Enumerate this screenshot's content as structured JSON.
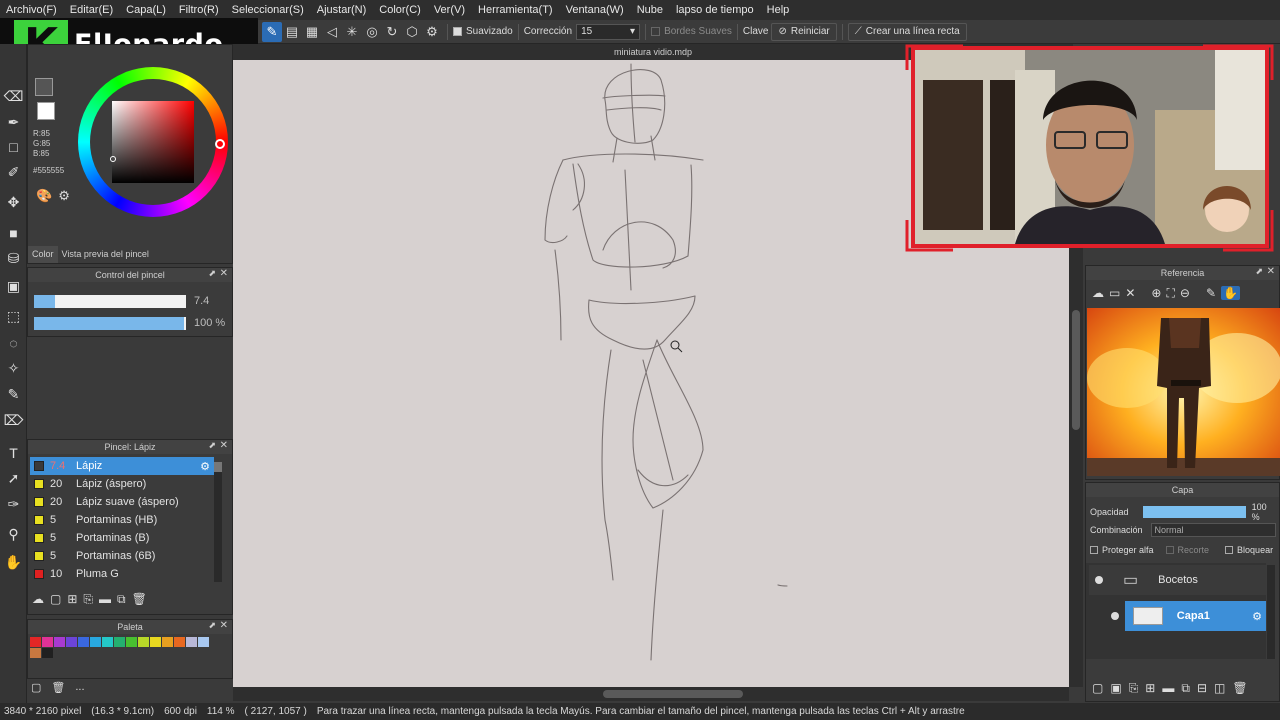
{
  "menu": [
    "Archivo(F)",
    "Editar(E)",
    "Capa(L)",
    "Filtro(R)",
    "Seleccionar(S)",
    "Ajustar(N)",
    "Color(C)",
    "Ver(V)",
    "Herramienta(T)",
    "Ventana(W)",
    "Nube",
    "lapso de tiempo",
    "Help"
  ],
  "logo": {
    "letter": "K",
    "name": "ElJonardo"
  },
  "options_bar": {
    "suavizado": "Suavizado",
    "correccion_label": "Corrección",
    "correccion_value": "15",
    "bordes_suaves": "Bordes Suaves",
    "clave": "Clave",
    "reiniciar": "Reiniciar",
    "linea_recta": "Crear una línea recta"
  },
  "canvas": {
    "tab_title": "miniatura vidio.mdp"
  },
  "color_panel": {
    "r": "R:85",
    "g": "G:85",
    "b": "B:85",
    "hex": "#555555",
    "tab_color": "Color",
    "tab_preview": "Vista previa del pincel",
    "fg_color": "#555555",
    "bg_color": "#ffffff"
  },
  "brush_control": {
    "title": "Control del pincel",
    "size_value": "7.4",
    "opacity_value": "100 %",
    "size_fraction": 0.14,
    "opacity_fraction": 1.0
  },
  "brush_list": {
    "title": "Pincel: Lápiz",
    "items": [
      {
        "size": "7.4",
        "name": "Lápiz",
        "color": "#3a3a3a"
      },
      {
        "size": "20",
        "name": "Lápiz (áspero)",
        "color": "#e8e020"
      },
      {
        "size": "20",
        "name": "Lápiz suave (áspero)",
        "color": "#e8e020"
      },
      {
        "size": "5",
        "name": "Portaminas (HB)",
        "color": "#e8e020"
      },
      {
        "size": "5",
        "name": "Portaminas (B)",
        "color": "#e8e020"
      },
      {
        "size": "5",
        "name": "Portaminas (6B)",
        "color": "#e8e020"
      },
      {
        "size": "10",
        "name": "Pluma G",
        "color": "#e02020"
      }
    ]
  },
  "palette": {
    "title": "Paleta",
    "more": "...",
    "colors": [
      "#e32626",
      "#e03296",
      "#a83ad1",
      "#6c44d8",
      "#3a68e0",
      "#28a8e0",
      "#24c8c8",
      "#24b070",
      "#48c030",
      "#b8d828",
      "#e8d820",
      "#e8a020",
      "#e86820",
      "#b8b8d8",
      "#a8c8f0",
      "#c87840",
      "#202020"
    ]
  },
  "reference": {
    "title": "Referencia"
  },
  "layer": {
    "title": "Capa",
    "opacity_label": "Opacidad",
    "opacity_value": "100 %",
    "opacity_fraction": 1.0,
    "blend_label": "Combinación",
    "blend_value": "Normal",
    "protect_alpha": "Proteger alfa",
    "clip": "Recorte",
    "lock": "Bloquear",
    "folder_name": "Bocetos",
    "layer_name": "Capa1"
  },
  "status": {
    "size": "3840 * 2160 pixel",
    "dims": "(16.3 * 9.1cm)",
    "dpi": "600 dpi",
    "zoom": "114 %",
    "coords": "( 2127, 1057 )",
    "hint": "Para trazar una línea recta, mantenga pulsada la tecla Mayús. Para cambiar el tamaño del pincel, mantenga pulsada las teclas Ctrl + Alt y arrastre"
  }
}
